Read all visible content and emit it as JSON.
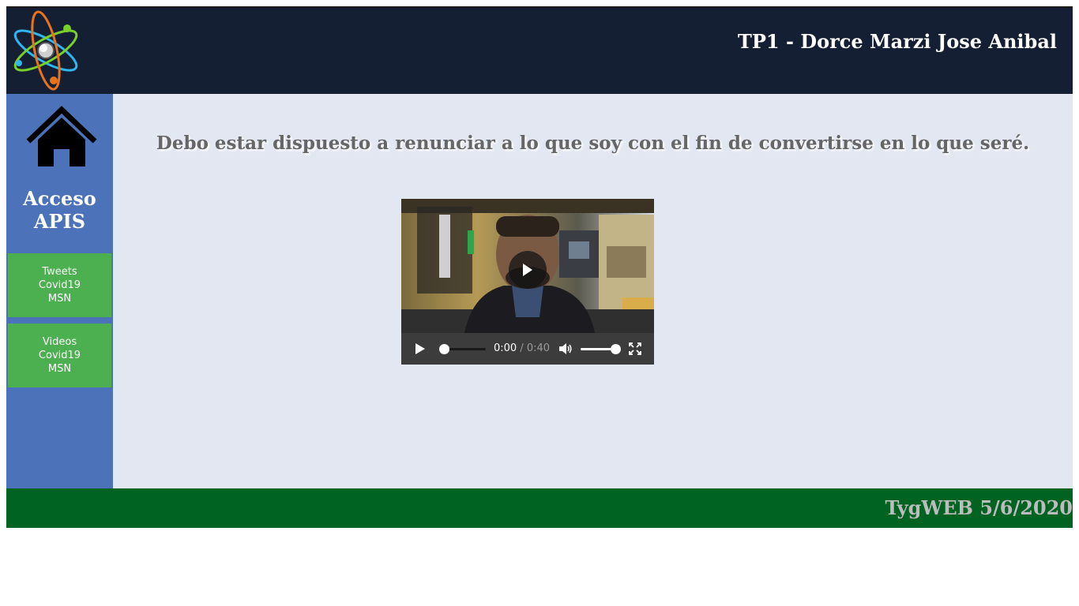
{
  "header": {
    "title": "TP1 - Dorce Marzi Jose Anibal",
    "logo_icon": "atom-logo-icon"
  },
  "sidebar": {
    "home_icon": "home-icon",
    "title_line1": "Acceso",
    "title_line2": "APIS",
    "buttons": [
      {
        "lines": [
          "Tweets",
          "Covid19",
          "MSN"
        ]
      },
      {
        "lines": [
          "Videos",
          "Covid19",
          "MSN"
        ]
      }
    ]
  },
  "main": {
    "quote": "Debo estar dispuesto a renunciar a lo que soy con el fin de convertirse en lo que seré.",
    "video": {
      "current_time": "0:00",
      "separator": " / ",
      "duration": "0:40",
      "progress_fraction": 0.0,
      "volume_fraction": 1.0
    }
  },
  "footer": {
    "text": "TygWEB 5/6/2020"
  },
  "colors": {
    "header_bg": "#151f33",
    "sidebar_bg": "#4c72b9",
    "button_bg": "#4caf50",
    "main_bg": "#e3e7f1",
    "footer_bg": "#006321"
  }
}
